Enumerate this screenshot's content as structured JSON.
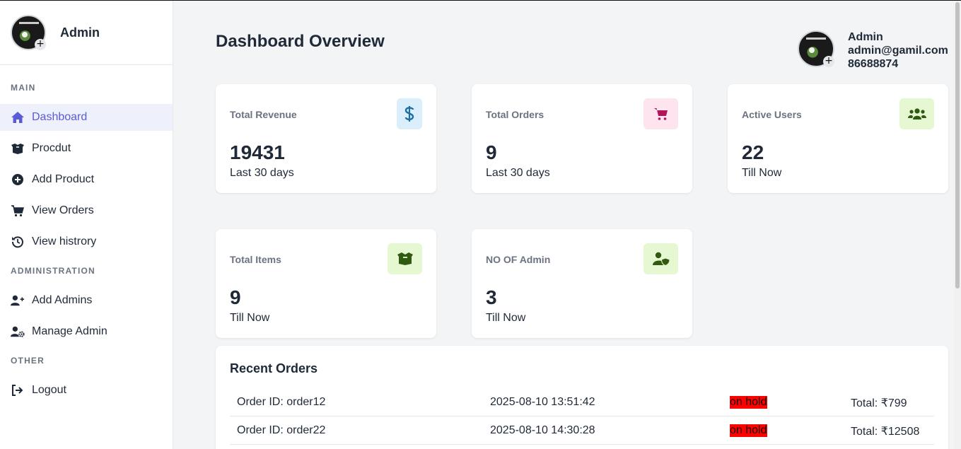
{
  "sidebar": {
    "brand_name": "Admin",
    "sections": {
      "main": "MAIN",
      "administration": "ADMINISTRATION",
      "other": "OTHER"
    },
    "items": [
      {
        "label": "Dashboard",
        "icon": "home-icon"
      },
      {
        "label": "Procdut",
        "icon": "box-open-icon"
      },
      {
        "label": "Add Product",
        "icon": "plus-circle-icon"
      },
      {
        "label": "View Orders",
        "icon": "cart-icon"
      },
      {
        "label": "View histrory",
        "icon": "history-icon"
      },
      {
        "label": "Add Admins",
        "icon": "user-plus-icon"
      },
      {
        "label": "Manage Admin",
        "icon": "user-gear-icon"
      },
      {
        "label": "Logout",
        "icon": "logout-icon"
      }
    ]
  },
  "header": {
    "title": "Dashboard Overview",
    "profile": {
      "name": "Admin",
      "email": "admin@gamil.com",
      "phone": "86688874"
    }
  },
  "cards": [
    {
      "label": "Total Revenue",
      "value": "19431",
      "sub": "Last 30 days",
      "icon": "dollar-icon",
      "icon_bg": "#dbeefb",
      "icon_color": "#1d6fa5"
    },
    {
      "label": "Total Orders",
      "value": "9",
      "sub": "Last 30 days",
      "icon": "cart-icon",
      "icon_bg": "#fde4ee",
      "icon_color": "#b0175a"
    },
    {
      "label": "Active Users",
      "value": "22",
      "sub": "Till Now",
      "icon": "users-icon",
      "icon_bg": "#e6f8d2",
      "icon_color": "#2f5a0f"
    },
    {
      "label": "Total Items",
      "value": "9",
      "sub": "Till Now",
      "icon": "box-icon",
      "icon_bg": "#e6f8d2",
      "icon_color": "#2f5a0f"
    },
    {
      "label": "NO OF Admin",
      "value": "3",
      "sub": "Till Now",
      "icon": "user-shield-icon",
      "icon_bg": "#e6f8d2",
      "icon_color": "#2f5a0f"
    }
  ],
  "recent_orders": {
    "title": "Recent Orders",
    "rows": [
      {
        "id": "Order ID: order12",
        "date": "2025-08-10 13:51:42",
        "status": "on hold",
        "total": "Total: ₹799"
      },
      {
        "id": "Order ID: order22",
        "date": "2025-08-10 14:30:28",
        "status": "on hold",
        "total": "Total: ₹12508"
      }
    ]
  },
  "colors": {
    "accent": "#5b5bd6",
    "active_bg": "#eef0fb",
    "status_on_hold": "#ff0000"
  }
}
